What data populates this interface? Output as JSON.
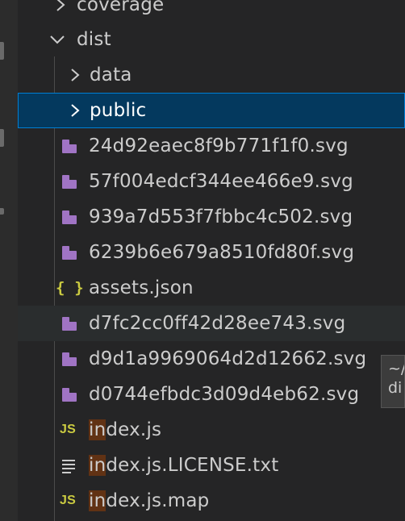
{
  "explorer": {
    "items": [
      {
        "label": "coverage",
        "type": "folder",
        "expanded": false
      },
      {
        "label": "dist",
        "type": "folder",
        "expanded": true
      },
      {
        "label": "data",
        "type": "folder",
        "expanded": false
      },
      {
        "label": "public",
        "type": "folder",
        "expanded": false,
        "selected": true
      },
      {
        "label": "24d92eaec8f9b771f1f0.svg",
        "type": "svg"
      },
      {
        "label": "57f004edcf344ee466e9.svg",
        "type": "svg"
      },
      {
        "label": "939a7d553f7fbbc4c502.svg",
        "type": "svg"
      },
      {
        "label": "6239b6e679a8510fd80f.svg",
        "type": "svg"
      },
      {
        "label": "assets.json",
        "type": "json"
      },
      {
        "label": "d7fc2cc0ff42d28ee743.svg",
        "type": "svg"
      },
      {
        "label": "d9d1a9969064d2d12662.svg",
        "type": "svg"
      },
      {
        "label": "d0744efbdc3d09d4eb62.svg",
        "type": "svg"
      },
      {
        "label_match": "in",
        "label_rest": "dex.js",
        "type": "js"
      },
      {
        "label_match": "in",
        "label_rest": "dex.js.LICENSE.txt",
        "type": "txt"
      },
      {
        "label_match": "in",
        "label_rest": "dex.js.map",
        "type": "js"
      }
    ]
  },
  "icons": {
    "json": "{ }",
    "js": "JS"
  },
  "tooltip": {
    "line1": "~/",
    "line2": "di"
  },
  "colors": {
    "selection_bg": "#04395e",
    "selection_border": "#007fd4",
    "svg_icon": "#a074c4",
    "js_icon": "#cbcb41",
    "match_highlight": "#613214"
  }
}
